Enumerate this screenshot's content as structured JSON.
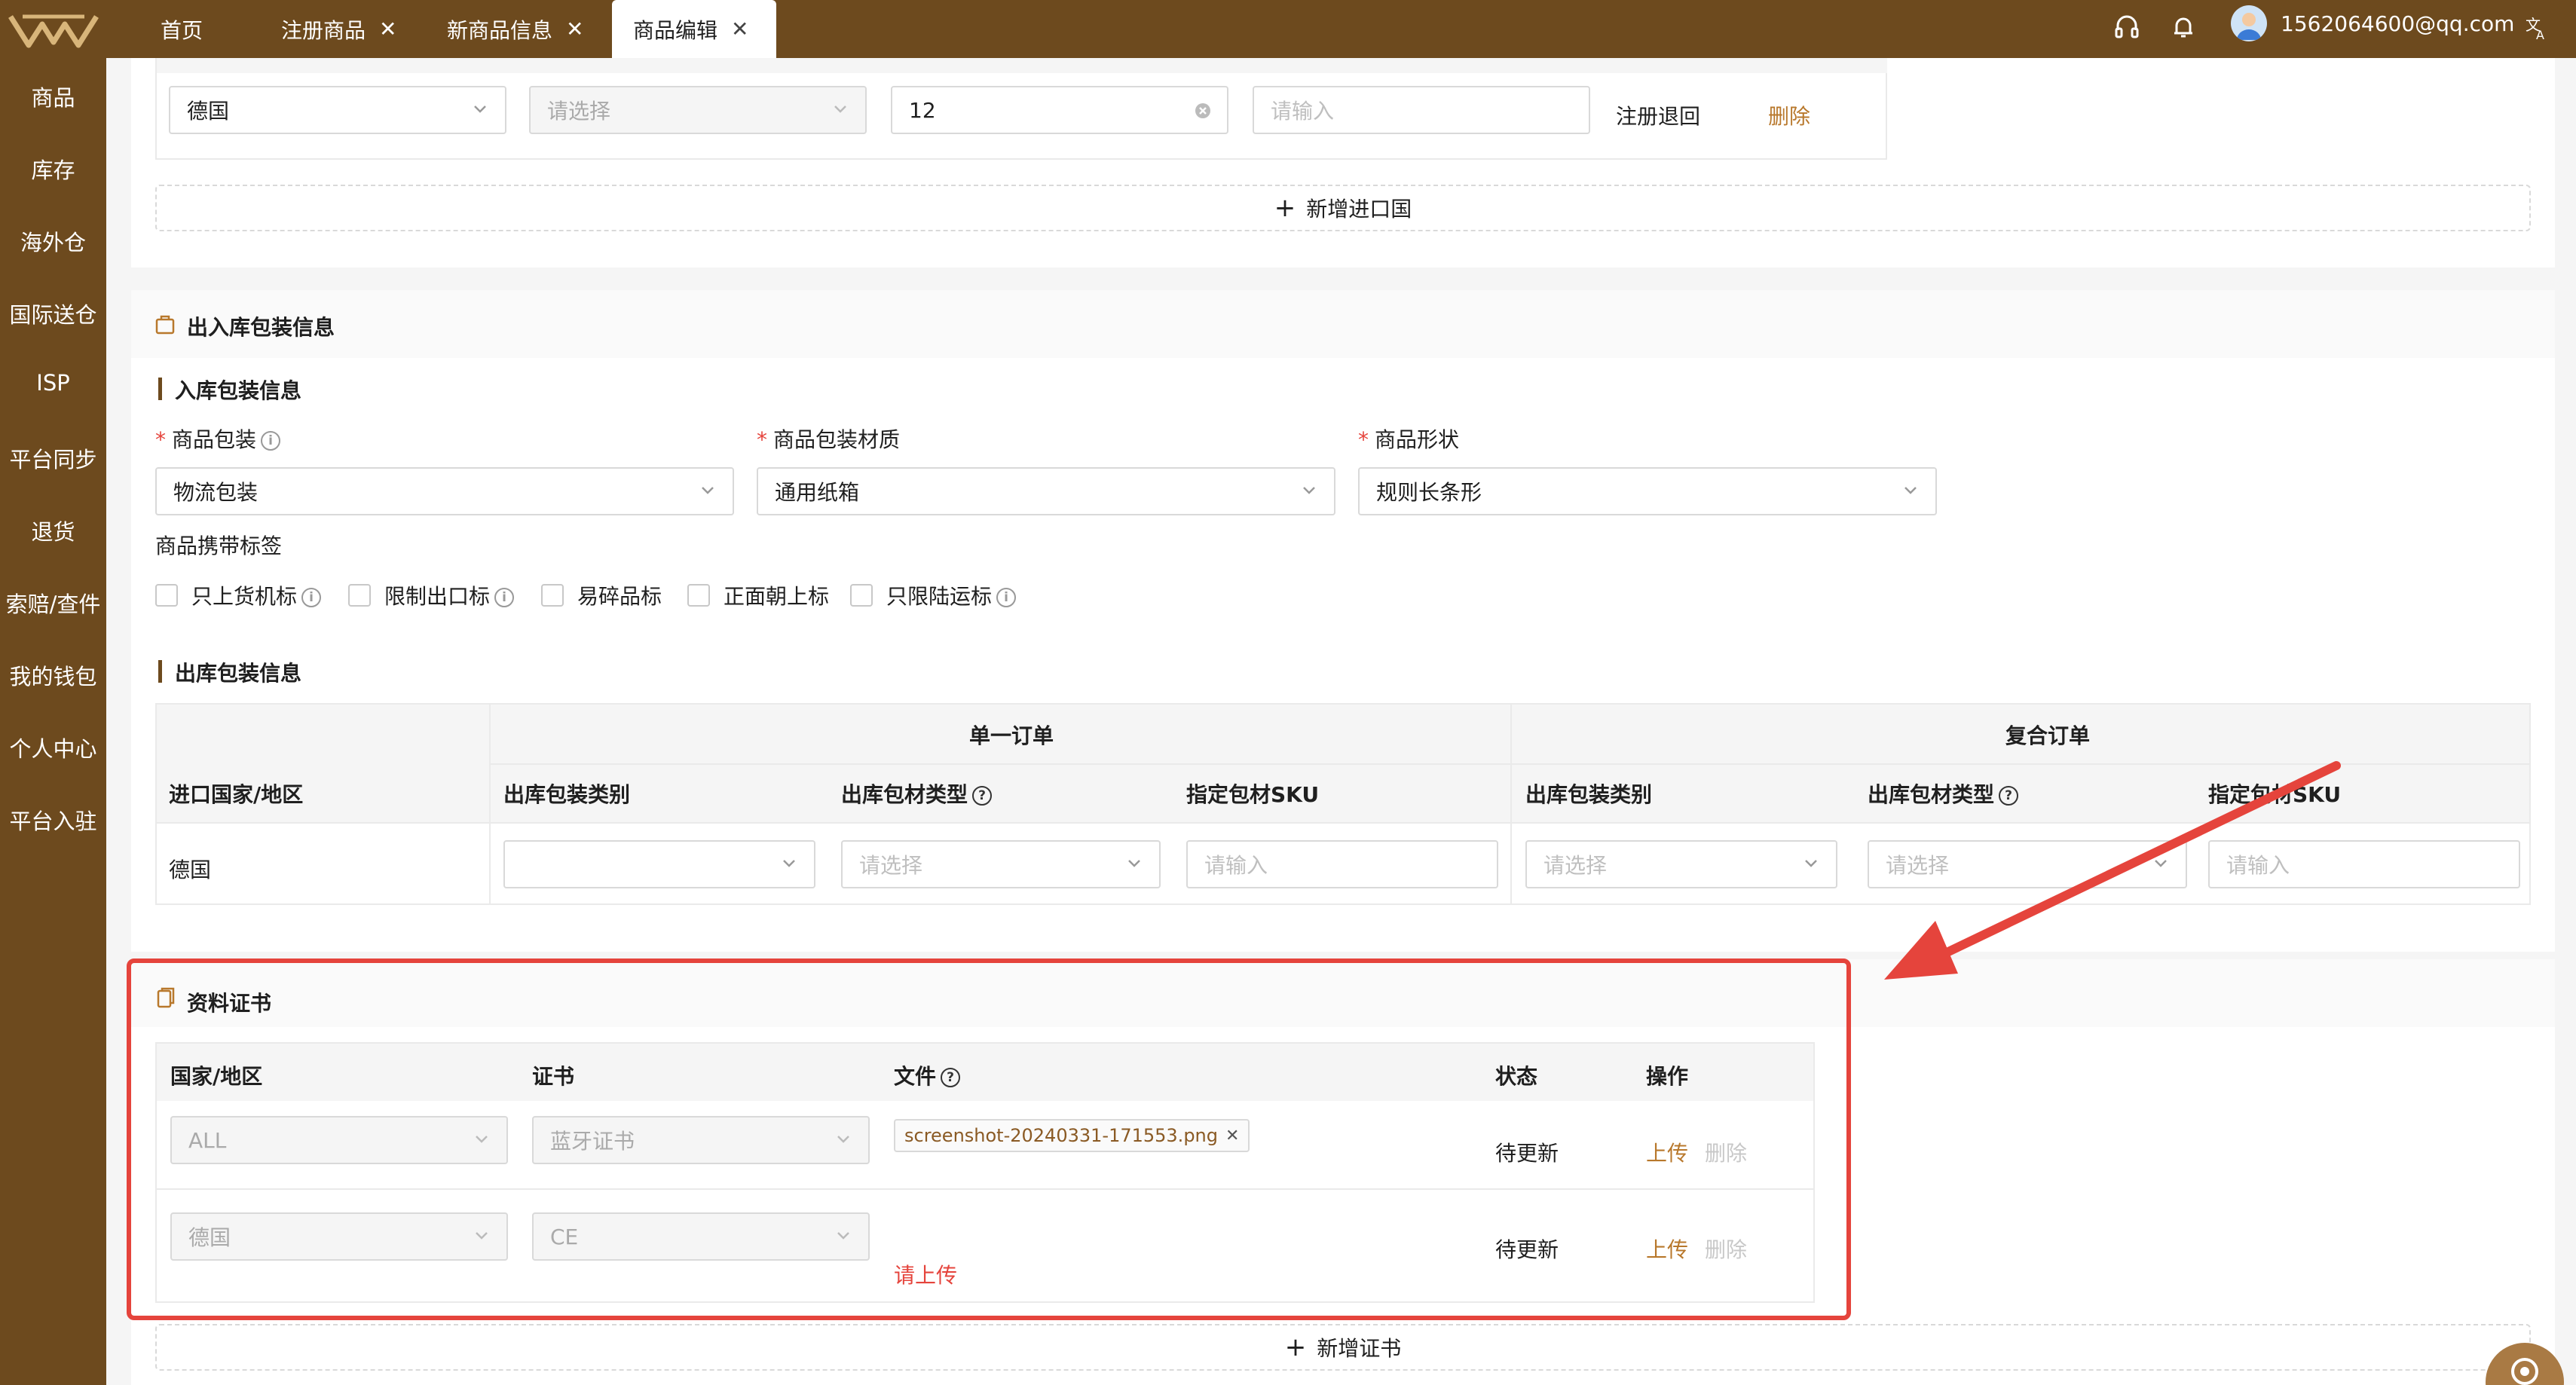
{
  "topbar": {
    "tabs": [
      {
        "label": "首页",
        "closable": false,
        "active": false
      },
      {
        "label": "注册商品",
        "closable": true,
        "active": false
      },
      {
        "label": "新商品信息",
        "closable": true,
        "active": false
      },
      {
        "label": "商品编辑",
        "closable": true,
        "active": true
      }
    ],
    "icons": [
      "headset-icon",
      "bell-icon",
      "translate-icon"
    ],
    "user_email": "1562064600@qq.com"
  },
  "sidebar": {
    "items": [
      "商品",
      "库存",
      "海外仓",
      "国际送仓",
      "ISP",
      "平台同步",
      "退货",
      "索赔/查件",
      "我的钱包",
      "个人中心",
      "平台入驻"
    ]
  },
  "import_row": {
    "country": "德国",
    "select_placeholder": "请选择",
    "number_value": "12",
    "input_placeholder": "请输入",
    "status": "注册退回",
    "delete": "删除"
  },
  "add_import_country": "新增进口国",
  "packaging": {
    "title": "出入库包装信息",
    "inbound_title": "入库包装信息",
    "fields": [
      {
        "label": "商品包装",
        "value": "物流包装",
        "info": true
      },
      {
        "label": "商品包装材质",
        "value": "通用纸箱",
        "info": false
      },
      {
        "label": "商品形状",
        "value": "规则长条形",
        "info": false
      }
    ],
    "tags_label": "商品携带标签",
    "tags": [
      {
        "label": "只上货机标",
        "info": true
      },
      {
        "label": "限制出口标",
        "info": true
      },
      {
        "label": "易碎品标",
        "info": false
      },
      {
        "label": "正面朝上标",
        "info": false
      },
      {
        "label": "只限陆运标",
        "info": true
      }
    ],
    "outbound_title": "出库包装信息",
    "group_single": "单一订单",
    "group_combo": "复合订单",
    "headers": [
      "进口国家/地区",
      "出库包装类别",
      "出库包材类型",
      "指定包材SKU",
      "出库包装类别",
      "出库包材类型",
      "指定包材SKU"
    ],
    "row_country": "德国",
    "ph_select": "请选择",
    "ph_input": "请输入"
  },
  "certificates": {
    "title": "资料证书",
    "headers": {
      "country": "国家/地区",
      "cert": "证书",
      "file": "文件",
      "status": "状态",
      "action": "操作"
    },
    "rows": [
      {
        "country": "ALL",
        "cert": "蓝牙证书",
        "file": "screenshot-20240331-171553.png",
        "status": "待更新",
        "upload": "上传",
        "delete": "删除"
      },
      {
        "country": "德国",
        "cert": "CE",
        "file_hint": "请上传",
        "status": "待更新",
        "upload": "上传",
        "delete": "删除"
      }
    ],
    "add_label": "新增证书"
  },
  "colors": {
    "brand": "#6d4a1e",
    "accent": "#b8782c",
    "highlight": "#e5443c"
  }
}
